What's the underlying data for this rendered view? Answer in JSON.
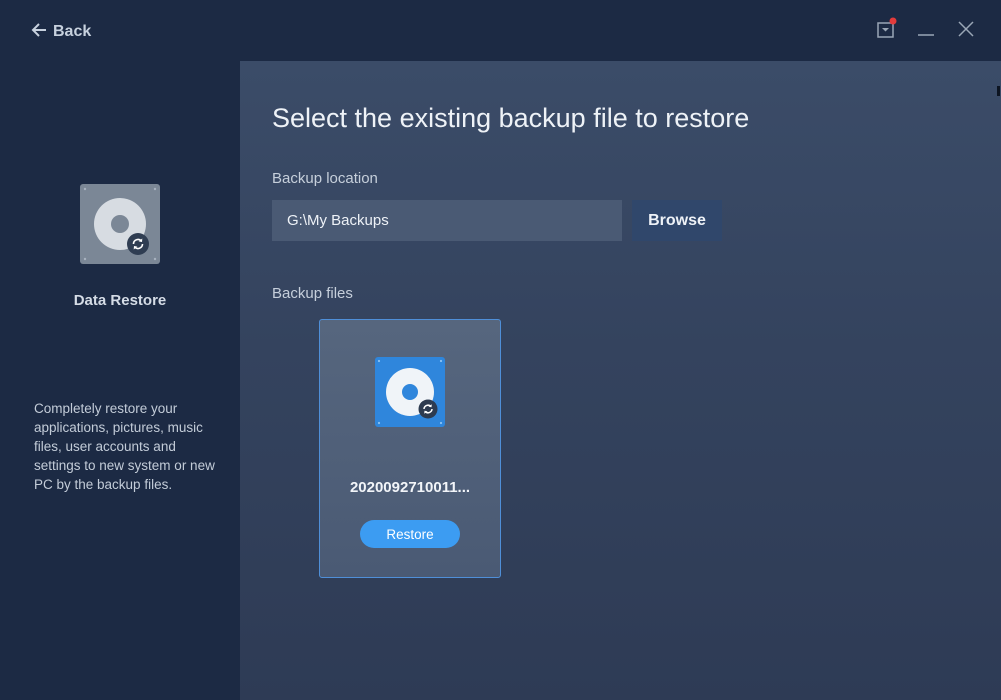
{
  "titlebar": {
    "back_label": "Back"
  },
  "sidebar": {
    "title": "Data Restore",
    "description": "Completely restore your applications, pictures, music files, user accounts and settings to new system or new PC by the backup files."
  },
  "main": {
    "heading": "Select the existing backup file to restore",
    "backup_location_label": "Backup location",
    "backup_location_value": "G:\\My Backups",
    "browse_label": "Browse",
    "backup_files_label": "Backup files",
    "files": [
      {
        "name": "2020092710011...",
        "restore_label": "Restore"
      }
    ]
  },
  "colors": {
    "background": "#1c2a44",
    "main_panel": "#3b4c68",
    "accent": "#3c9cf2",
    "card_border": "#4f8fd8",
    "notification_dot": "#e23b3b"
  },
  "icons": [
    "back-arrow-icon",
    "notification-icon",
    "minimize-icon",
    "close-icon",
    "disk-restore-icon"
  ]
}
